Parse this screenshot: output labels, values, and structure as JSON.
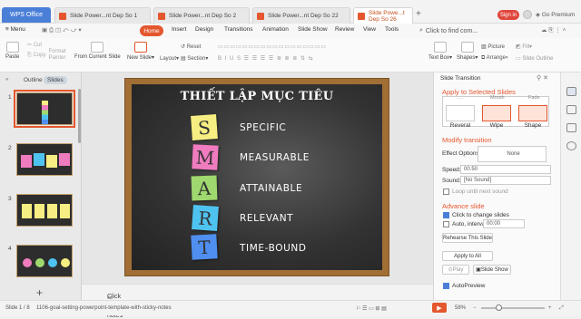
{
  "titlebar": {
    "wps_tab": "WPS Office",
    "tabs": [
      {
        "label": "Slide Power...nt Dep So 1"
      },
      {
        "label": "Slide Power...nt Dep So 2"
      },
      {
        "label": "Slide Power...nt Dep So 22"
      },
      {
        "label": "Slide Powe...t Dep So 26"
      }
    ],
    "sign_in": "Sign in",
    "go_premium": "Go Premium"
  },
  "menubar": {
    "menu_label": "Menu",
    "items": [
      "Home",
      "Insert",
      "Design",
      "Transitions",
      "Animation",
      "Slide Show",
      "Review",
      "View",
      "Tools"
    ],
    "search_placeholder": "Click to find com..."
  },
  "ribbon": {
    "paste": "Paste",
    "cut": "Cut",
    "copy": "Copy",
    "format_painter": "Format Painter",
    "from_current_slide": "From Current Slide",
    "new_slide": "New Slide",
    "layout": "Layout",
    "reset": "Reset",
    "section": "Section",
    "text_box": "Text Box",
    "shapes": "Shapes",
    "picture": "Picture",
    "fill": "Fill",
    "arrange": "Arrange",
    "slide_outline": "Slide Outline"
  },
  "left_panel": {
    "tabs": [
      "Outline",
      "Slides"
    ],
    "slide_numbers": [
      "1",
      "2",
      "3",
      "4"
    ]
  },
  "slide": {
    "title": "THIẾT LẬP MỤC TIÊU",
    "letters": [
      "S",
      "M",
      "A",
      "R",
      "T"
    ],
    "note_colors": [
      "#f6ee82",
      "#f07cc0",
      "#9fd86e",
      "#4fc3f0",
      "#4f8ff0"
    ],
    "words": [
      "SPECIFIC",
      "MEASURABLE",
      "ATTAINABLE",
      "RELEVANT",
      "TIME-BOUND"
    ]
  },
  "notes": {
    "placeholder": "Click to add notes"
  },
  "right_panel": {
    "title": "Slide Transition",
    "apply_heading": "Apply to Selected Slides",
    "partial_labels": [
      "Morph",
      "Fade"
    ],
    "transitions": [
      "Reveral",
      "Wipe",
      "Shape"
    ],
    "modify_heading": "Modify transition",
    "effect_options_label": "Effect Options:",
    "effect_options_value": "None",
    "speed_label": "Speed:",
    "speed_value": "00.50",
    "sound_label": "Sound:",
    "sound_value": "[No Sound]",
    "loop_label": "Loop until next sound",
    "advance_heading": "Advance slide",
    "click_label": "Click to change slides",
    "auto_label": "Auto, interval:",
    "auto_value": "00:00",
    "rehearse": "Rehearse This Slide",
    "apply_all": "Apply to All",
    "play": "Play",
    "slide_show": "Slide Show",
    "autopreview": "AutoPreview"
  },
  "statusbar": {
    "slide_count": "Slide 1 / 8",
    "filename": "1106-goal-setting-powerpoint-template-with-sticky-notes",
    "zoom": "58%"
  }
}
